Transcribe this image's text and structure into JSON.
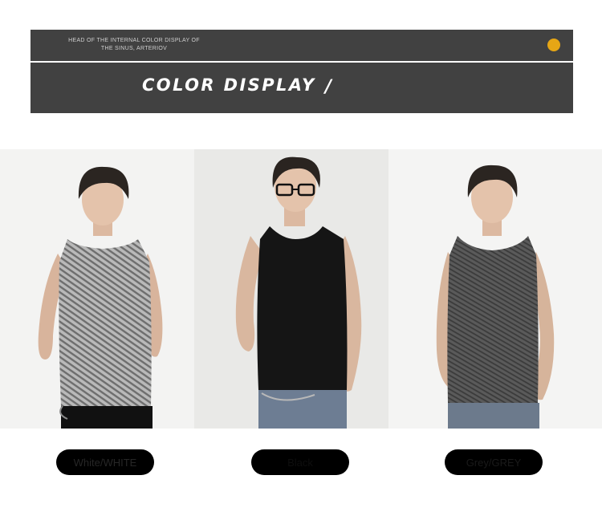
{
  "header": {
    "subtitle": "HEAD OF THE INTERNAL COLOR DISPLAY OF THE SINUS, ARTERIOV",
    "title": "COLOR DISPLAY",
    "slash": "/",
    "accent_color": "#e6a615",
    "banner_color": "#414141"
  },
  "colors": [
    {
      "label": "White/WHITE",
      "shirt_color": "#a9a9a9"
    },
    {
      "label": "Black",
      "shirt_color": "#151515"
    },
    {
      "label": "Grey/GREY",
      "shirt_color": "#4f4f4f"
    }
  ]
}
